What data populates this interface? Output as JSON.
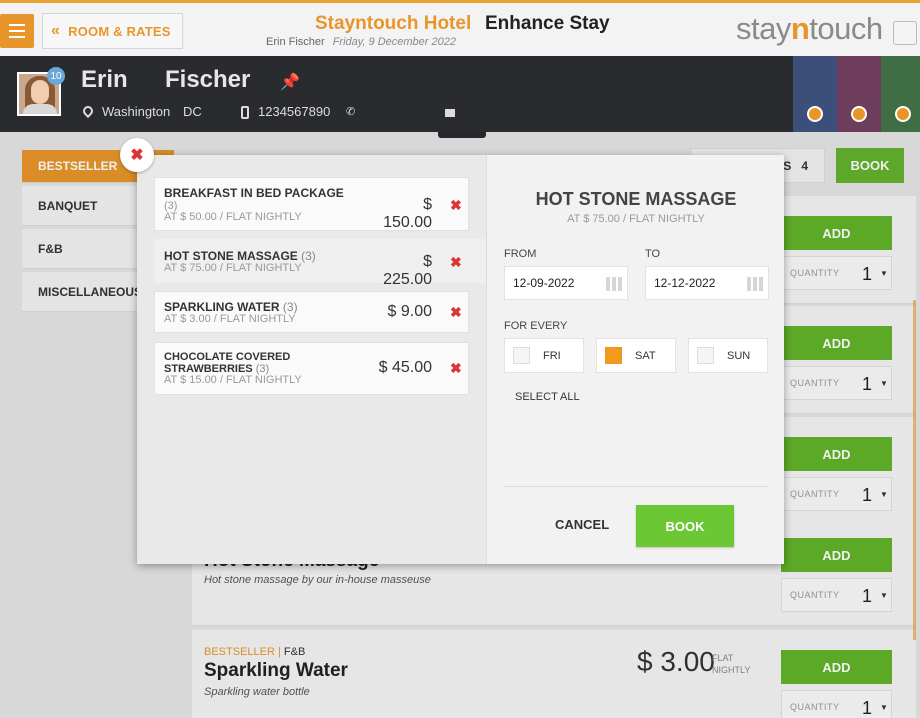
{
  "header": {
    "menu_icon": "hamburger-icon",
    "back_label": "ROOM & RATES",
    "hotel_name": "Stayntouch Hotel",
    "page_title": "Enhance Stay",
    "guest_name": "Erin Fischer",
    "date": "Friday, 9 December 2022",
    "brand_pre": "stay",
    "brand_mid": "n",
    "brand_post": "touch",
    "accent_color": "#e8962a"
  },
  "guest": {
    "badge": "10",
    "first_name": "Erin",
    "last_name": "Fischer",
    "city": "Washington",
    "state": "DC",
    "phone": "1234567890"
  },
  "categories": [
    "BESTSELLER",
    "BANQUET",
    "F&B",
    "MISCELLANEOUS"
  ],
  "toolbar": {
    "items_count": "4",
    "book_label": "BOOK",
    "items_suffix": "S"
  },
  "cards": [
    {
      "add": "ADD",
      "qty_label": "QUANTITY",
      "qty": "1"
    },
    {
      "add": "ADD",
      "qty_label": "QUANTITY",
      "qty": "1"
    },
    {
      "add": "ADD",
      "qty_label": "QUANTITY",
      "qty": "1"
    },
    {
      "add": "ADD",
      "qty_label": "QUANTITY",
      "qty": "1",
      "name": "Hot Stone Massage",
      "desc": "Hot stone massage by our in-house masseuse"
    },
    {
      "add": "ADD",
      "qty_label": "QUANTITY",
      "qty": "1",
      "tag": "BESTSELLER",
      "tag2": "F&B",
      "name": "Sparkling Water",
      "desc": "Sparkling water bottle",
      "price": "$ 3.00",
      "unit1": "FLAT",
      "unit2": "NIGHTLY"
    }
  ],
  "modal": {
    "items": [
      {
        "name": "BREAKFAST IN BED PACKAGE",
        "qty": "(3)",
        "rate": "AT $ 50.00 / FLAT NIGHTLY",
        "price": "$ 150.00"
      },
      {
        "name": "HOT STONE MASSAGE",
        "qty": "(3)",
        "rate": "AT $ 75.00 / FLAT NIGHTLY",
        "price": "$ 225.00"
      },
      {
        "name": "SPARKLING WATER",
        "qty": "(3)",
        "rate": "AT $ 3.00 / FLAT NIGHTLY",
        "price": "$ 9.00"
      },
      {
        "name": "CHOCOLATE COVERED",
        "name2": "STRAWBERRIES",
        "qty": "(3)",
        "rate": "AT $ 15.00 / FLAT NIGHTLY",
        "price": "$ 45.00"
      }
    ],
    "detail_title": "HOT STONE MASSAGE",
    "detail_rate": "AT $ 75.00 / FLAT NIGHTLY",
    "from_label": "FROM",
    "to_label": "TO",
    "from_date": "12-09-2022",
    "to_date": "12-12-2022",
    "for_every_label": "FOR EVERY",
    "days": [
      {
        "label": "FRI",
        "checked": false
      },
      {
        "label": "SAT",
        "checked": true
      },
      {
        "label": "SUN",
        "checked": false
      }
    ],
    "select_all": "SELECT ALL",
    "cancel": "CANCEL",
    "book": "BOOK"
  }
}
